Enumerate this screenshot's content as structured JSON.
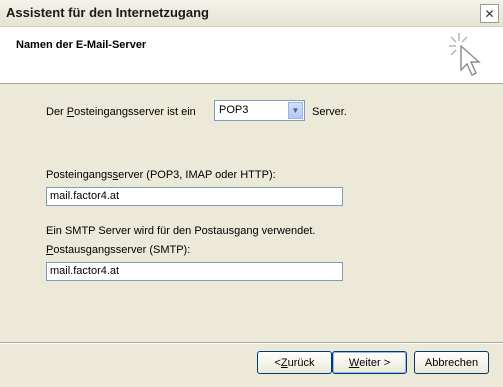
{
  "window": {
    "title": "Assistent für den Internetzugang",
    "close_symbol": "✕"
  },
  "header": {
    "title": "Namen der E-Mail-Server"
  },
  "form": {
    "incoming_type_prefix": "Der ",
    "incoming_type_underlined": "P",
    "incoming_type_rest": "osteingangsserver ist ein",
    "incoming_type_value": "POP3",
    "incoming_type_suffix": "Server.",
    "incoming_label_a": "Posteingangs",
    "incoming_label_u": "s",
    "incoming_label_b": "erver (POP3, IMAP oder HTTP):",
    "incoming_value": "mail.factor4.at",
    "smtp_note": "Ein SMTP Server wird für den Postausgang verwendet.",
    "outgoing_label_u": "P",
    "outgoing_label_rest": "ostausgangsserver (SMTP):",
    "outgoing_value": "mail.factor4.at"
  },
  "buttons": {
    "back_prefix": "< ",
    "back_u": "Z",
    "back_rest": "urück",
    "next_u": "W",
    "next_rest": "eiter >",
    "cancel": "Abbrechen"
  }
}
